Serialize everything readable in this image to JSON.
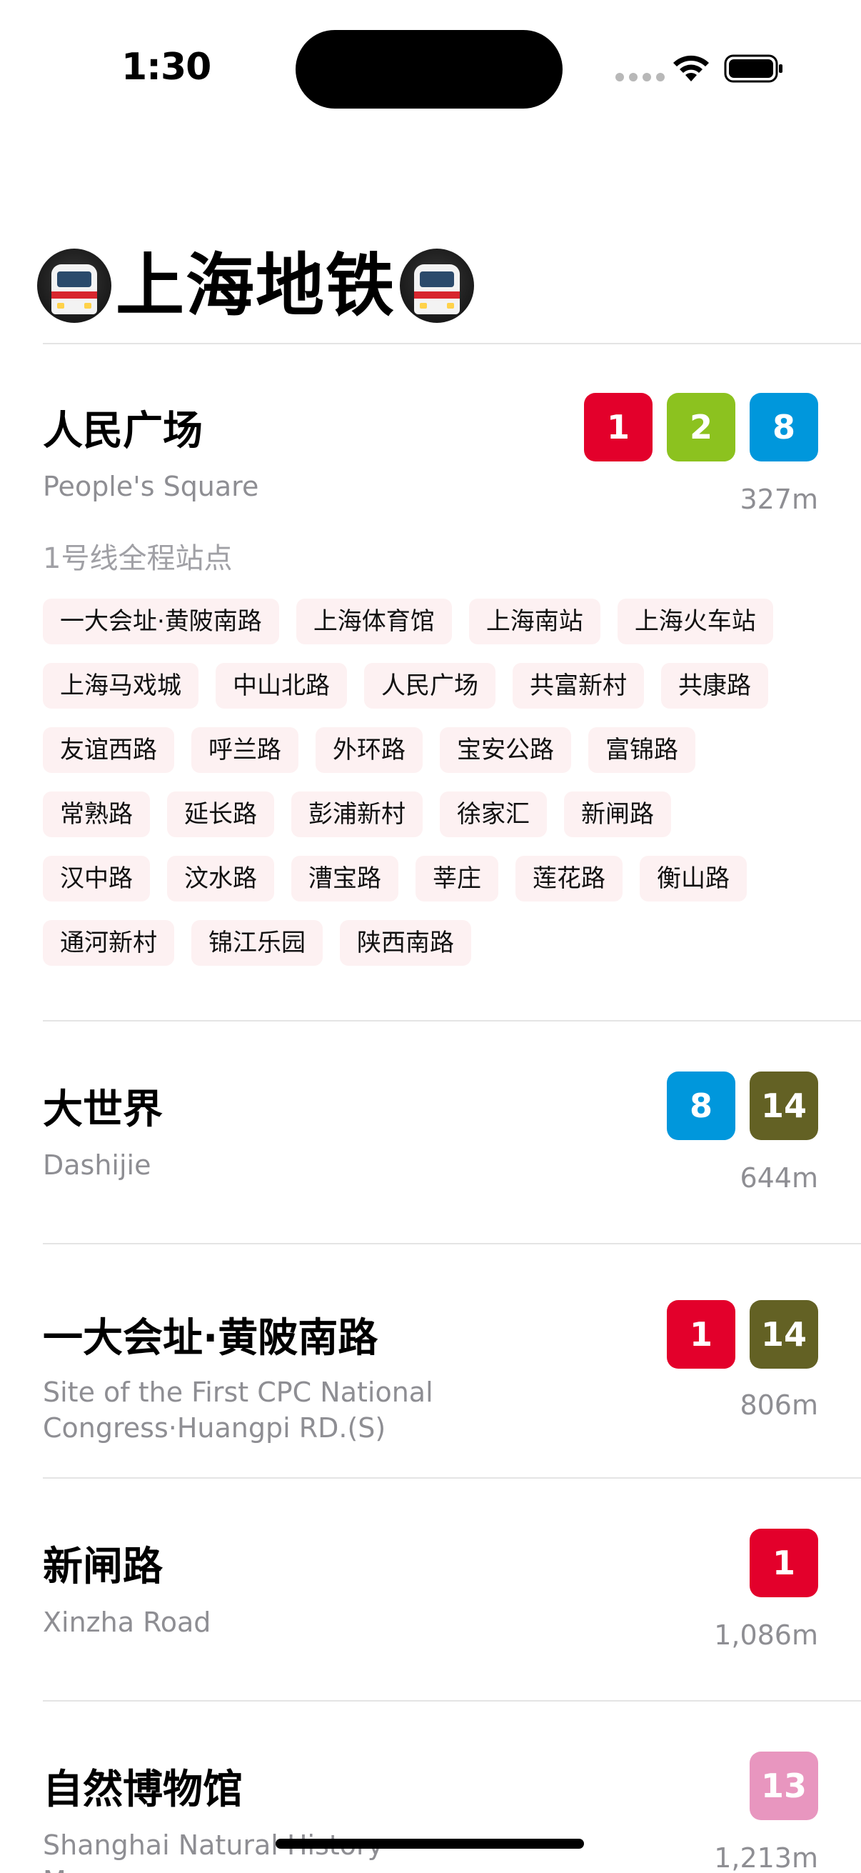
{
  "status_bar": {
    "time": "1:30"
  },
  "app": {
    "title": "上海地铁"
  },
  "icons": {
    "title_left": "train-emoji-icon",
    "title_right": "train-emoji-icon",
    "wifi": "wifi-icon",
    "battery": "battery-icon",
    "signal": "cellular-signal-icon"
  },
  "line_colors": {
    "1": "#e3002b",
    "2": "#8cc21f",
    "8": "#0097dc",
    "13": "#e896bf",
    "14": "#636124"
  },
  "stations": [
    {
      "name": "人民广场",
      "english": "People's Square",
      "lines": [
        "1",
        "2",
        "8"
      ],
      "distance": "327m"
    },
    {
      "name": "大世界",
      "english": "Dashijie",
      "lines": [
        "8",
        "14"
      ],
      "distance": "644m"
    },
    {
      "name": "一大会址·黄陂南路",
      "english": "Site of the First CPC National Congress·Huangpi RD.(S)",
      "lines": [
        "1",
        "14"
      ],
      "distance": "806m"
    },
    {
      "name": "新闸路",
      "english": "Xinzha Road",
      "lines": [
        "1"
      ],
      "distance": "1,086m"
    },
    {
      "name": "自然博物馆",
      "english": "Shanghai Natural History Museum",
      "lines": [
        "13"
      ],
      "distance": "1,213m"
    }
  ],
  "line_detail": {
    "title": "1号线全程站点",
    "stops": [
      "一大会址·黄陂南路",
      "上海体育馆",
      "上海南站",
      "上海火车站",
      "上海马戏城",
      "中山北路",
      "人民广场",
      "共富新村",
      "共康路",
      "友谊西路",
      "呼兰路",
      "外环路",
      "宝安公路",
      "富锦路",
      "常熟路",
      "延长路",
      "彭浦新村",
      "徐家汇",
      "新闸路",
      "汉中路",
      "汶水路",
      "漕宝路",
      "莘庄",
      "莲花路",
      "衡山路",
      "通河新村",
      "锦江乐园",
      "陕西南路"
    ]
  }
}
